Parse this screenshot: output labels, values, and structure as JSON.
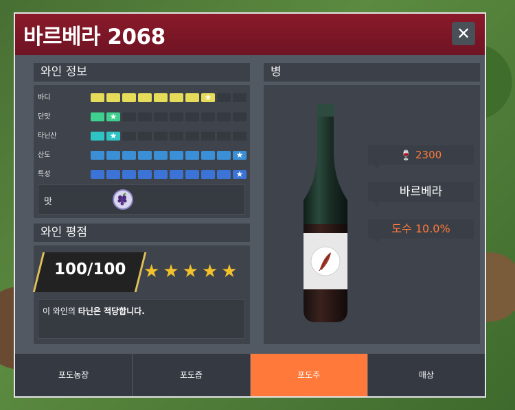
{
  "window": {
    "title": "바르베라 2068",
    "close_label": "✕"
  },
  "wine_info": {
    "header": "와인 정보",
    "stats": [
      {
        "label": "바디",
        "level": 8,
        "segments": 10,
        "color": "#e6dc5a"
      },
      {
        "label": "단맛",
        "level": 2,
        "segments": 10,
        "color": "#3fcf8e"
      },
      {
        "label": "타닌산",
        "level": 2,
        "segments": 10,
        "color": "#2fc4c4"
      },
      {
        "label": "산도",
        "level": 10,
        "segments": 10,
        "color": "#3b8fd6"
      },
      {
        "label": "특성",
        "level": 10,
        "segments": 10,
        "color": "#3b73d6"
      }
    ],
    "taste_label": "맛",
    "taste_icon": "grape-icon"
  },
  "rating": {
    "header": "와인 평점",
    "score": "100/100",
    "stars": 5,
    "comment_prefix": "이 와인의 ",
    "comment_bold": "타닌은 적당합니다."
  },
  "bottle": {
    "header": "병",
    "count": "2300",
    "count_icon": "bottles-icon",
    "name": "바르베라",
    "abv": "도수 10.0%"
  },
  "tabs": [
    {
      "label": "포도농장",
      "active": false
    },
    {
      "label": "포도즙",
      "active": false
    },
    {
      "label": "포도주",
      "active": true
    },
    {
      "label": "매상",
      "active": false
    }
  ],
  "colors": {
    "title_bar": "#8a1a2a",
    "accent": "#ff7a3a",
    "star": "#f2c12b"
  }
}
